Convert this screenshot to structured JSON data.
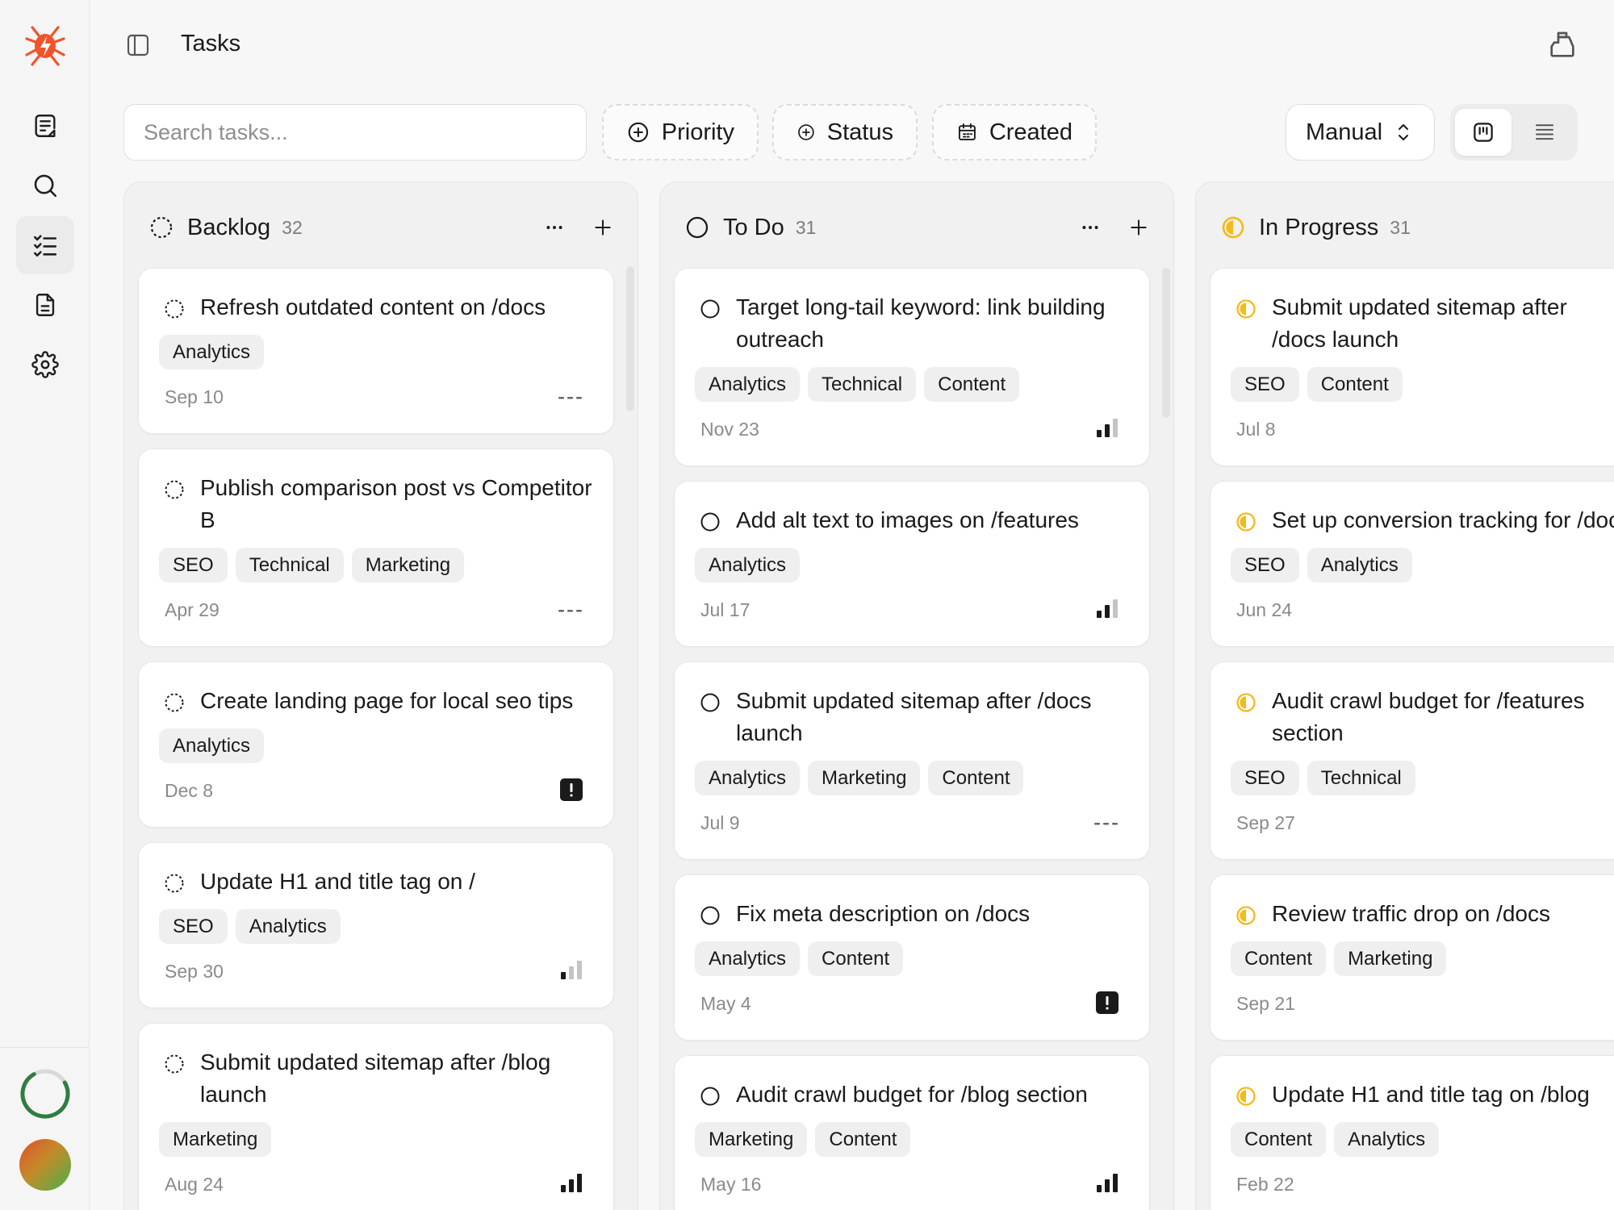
{
  "app": {
    "page_title": "Tasks"
  },
  "toolbar": {
    "search_placeholder": "Search tasks...",
    "filters": [
      "Priority",
      "Status",
      "Created"
    ],
    "sort_label": "Manual",
    "views": [
      "board-view-icon",
      "list-view-icon"
    ],
    "active_view": "board"
  },
  "nav": {
    "items": [
      "notes-icon",
      "search-icon",
      "tasks-icon",
      "document-icon",
      "settings-icon"
    ],
    "active": "tasks-icon"
  },
  "columns": [
    {
      "title": "Backlog",
      "count": "32",
      "status_icon": "backlog-dashed-circle-icon",
      "cards": [
        {
          "title": "Refresh outdated content on /docs",
          "tags": [
            "Analytics"
          ],
          "date": "Sep 10",
          "priority": "no-priority-icon"
        },
        {
          "title": "Publish comparison post vs Competitor B",
          "tags": [
            "SEO",
            "Technical",
            "Marketing"
          ],
          "date": "Apr 29",
          "priority": "no-priority-icon"
        },
        {
          "title": "Create landing page for local seo tips",
          "tags": [
            "Analytics"
          ],
          "date": "Dec 8",
          "priority": "urgent-priority-icon"
        },
        {
          "title": "Update H1 and title tag on /",
          "tags": [
            "SEO",
            "Analytics"
          ],
          "date": "Sep 30",
          "priority": "low-priority-icon"
        },
        {
          "title": "Submit updated sitemap after /blog launch",
          "tags": [
            "Marketing"
          ],
          "date": "Aug 24",
          "priority": "high-priority-icon"
        }
      ]
    },
    {
      "title": "To Do",
      "count": "31",
      "status_icon": "todo-circle-icon",
      "cards": [
        {
          "title": "Target long-tail keyword: link building outreach",
          "tags": [
            "Analytics",
            "Technical",
            "Content"
          ],
          "date": "Nov 23",
          "priority": "medium-priority-icon"
        },
        {
          "title": "Add alt text to images on /features",
          "tags": [
            "Analytics"
          ],
          "date": "Jul 17",
          "priority": "medium-priority-icon"
        },
        {
          "title": "Submit updated sitemap after /docs launch",
          "tags": [
            "Analytics",
            "Marketing",
            "Content"
          ],
          "date": "Jul 9",
          "priority": "no-priority-icon"
        },
        {
          "title": "Fix meta description on /docs",
          "tags": [
            "Analytics",
            "Content"
          ],
          "date": "May 4",
          "priority": "urgent-priority-icon"
        },
        {
          "title": "Audit crawl budget for /blog section",
          "tags": [
            "Marketing",
            "Content"
          ],
          "date": "May 16",
          "priority": "high-priority-icon"
        }
      ]
    },
    {
      "title": "In Progress",
      "count": "31",
      "status_icon": "in-progress-half-circle-icon",
      "cards": [
        {
          "title": "Submit updated sitemap after /docs launch",
          "tags": [
            "SEO",
            "Content"
          ],
          "date": "Jul 8"
        },
        {
          "title": "Set up conversion tracking for /docs",
          "tags": [
            "SEO",
            "Analytics"
          ],
          "date": "Jun 24"
        },
        {
          "title": "Audit crawl budget for /features section",
          "tags": [
            "SEO",
            "Technical"
          ],
          "date": "Sep 27"
        },
        {
          "title": "Review traffic drop on /docs",
          "tags": [
            "Content",
            "Marketing"
          ],
          "date": "Sep 21"
        },
        {
          "title": "Update H1 and title tag on /blog",
          "tags": [
            "Content",
            "Analytics"
          ],
          "date": "Feb 22"
        }
      ]
    }
  ],
  "colors": {
    "brand": "#f0542a",
    "in_progress": "#f3bb1c",
    "urgent": "#1a1a1a",
    "progress_ring": "#2f7d3f"
  }
}
